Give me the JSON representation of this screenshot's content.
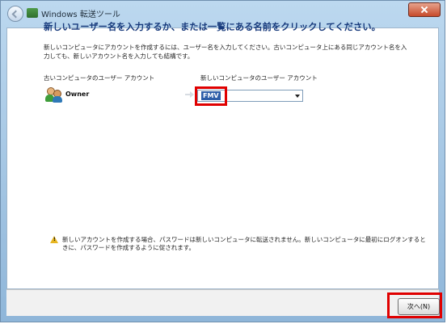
{
  "window": {
    "title": "Windows 転送ツール"
  },
  "main": {
    "heading": "新しいユーザー名を入力するか、または一覧にある名前をクリックしてください。",
    "description": "新しいコンピュータにアカウントを作成するには、ユーザー名を入力してください。古いコンピュータ上にある同じアカウント名を入力しても、新しいアカウント名を入力しても結構です。",
    "old_account_label": "古いコンピュータのユーザー アカウント",
    "new_account_label": "新しいコンピュータのユーザー アカウント",
    "user": {
      "name": "Owner"
    },
    "new_account_field": {
      "value": "FMV"
    },
    "warning": "新しいアカウントを作成する場合、パスワードは新しいコンピュータに転送されません。新しいコンピュータに最初にログオンするときに、パスワードを作成するように促されます。"
  },
  "footer": {
    "next_label": "次へ(N)"
  },
  "colors": {
    "heading": "#173a7c",
    "highlight": "#e00000",
    "selected_text": "#2d5ea8"
  }
}
